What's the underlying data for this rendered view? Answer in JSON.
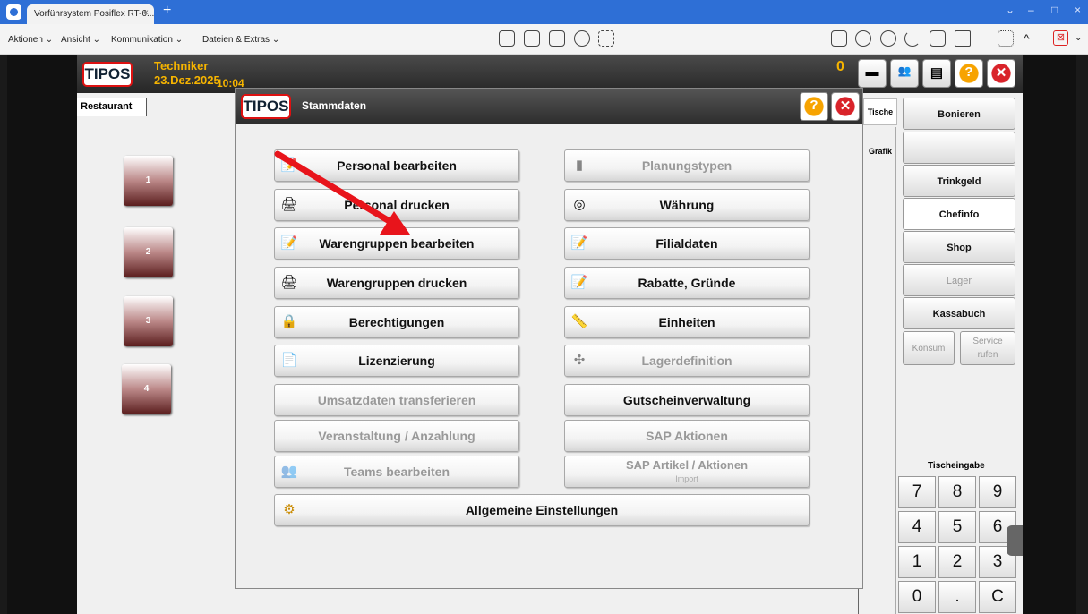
{
  "client": {
    "tab_title": "Vorführsystem Posiflex RT-6...",
    "tab_close": "×",
    "new_tab": "+",
    "window_controls": [
      "⌄",
      "–",
      "□",
      "×"
    ],
    "menus": [
      "Aktionen ⌄",
      "Ansicht ⌄",
      "Kommunikation ⌄",
      "Dateien & Extras ⌄"
    ],
    "toolbar_icons": [
      "monitor-icon",
      "keyboard-icon",
      "file-transfer-icon",
      "camera-icon",
      "grid-icon",
      "clipboard-icon",
      "chat-icon",
      "webcam-icon",
      "call-icon",
      "whiteboard-icon",
      "screenshot-icon",
      "fullscreen-icon",
      "collapse-icon",
      "disconnect-icon"
    ],
    "collapse": "^",
    "disconnect": "⊠",
    "more": "⌄"
  },
  "pos": {
    "logo": "TIPOS",
    "user": "Techniker",
    "date": "23.Dez.2025",
    "time": "10:04",
    "count": "0",
    "header_buttons": {
      "table": "▬",
      "users": "👥",
      "list": "▤",
      "help": "?",
      "close": "✕"
    }
  },
  "restaurant": {
    "tab": "Restaurant",
    "tables": [
      "1",
      "2",
      "3",
      "4"
    ]
  },
  "side_tabs": {
    "tische": "Tische",
    "grafik": "Grafik"
  },
  "right_buttons": [
    {
      "label": "Bonieren",
      "state": "enabled"
    },
    {
      "label": "",
      "state": "enabled"
    },
    {
      "label": "Trinkgeld",
      "state": "enabled"
    },
    {
      "label": "Chefinfo",
      "state": "selected"
    },
    {
      "label": "Shop",
      "state": "enabled"
    },
    {
      "label": "Lager",
      "state": "disabled"
    },
    {
      "label": "Kassabuch",
      "state": "enabled"
    }
  ],
  "small_buttons": {
    "konsum": "Konsum",
    "service_1": "Service",
    "service_2": "rufen"
  },
  "numpad": {
    "label": "Tischeingabe",
    "keys": [
      "7",
      "8",
      "9",
      "4",
      "5",
      "6",
      "1",
      "2",
      "3",
      "0",
      ".",
      "C"
    ]
  },
  "dialog": {
    "logo": "TIPOS",
    "title": "Stammdaten",
    "help": "?",
    "close": "✕",
    "left_buttons": [
      {
        "label": "Personal bearbeiten",
        "icon": "edit-person-icon",
        "glyph": "📝",
        "state": "enabled"
      },
      {
        "label": "Personal drucken",
        "icon": "printer-icon",
        "glyph": "🖨",
        "state": "enabled"
      },
      {
        "label": "Warengruppen bearbeiten",
        "icon": "edit-notepad-icon",
        "glyph": "📝",
        "state": "enabled"
      },
      {
        "label": "Warengruppen drucken",
        "icon": "printer-icon",
        "glyph": "🖨",
        "state": "enabled"
      },
      {
        "label": "Berechtigungen",
        "icon": "lock-user-icon",
        "glyph": "🔒",
        "state": "enabled"
      },
      {
        "label": "Lizenzierung",
        "icon": "license-certificate-icon",
        "glyph": "📄",
        "state": "enabled"
      },
      {
        "label": "Umsatzdaten transferieren",
        "icon": "",
        "glyph": "",
        "state": "disabled"
      },
      {
        "label": "Veranstaltung / Anzahlung",
        "icon": "",
        "glyph": "",
        "state": "disabled"
      },
      {
        "label": "Teams bearbeiten",
        "icon": "team-icon",
        "glyph": "👥",
        "state": "disabled"
      }
    ],
    "right_buttons": [
      {
        "label": "Planungstypen",
        "icon": "bar-chart-icon",
        "glyph": "▮",
        "state": "disabled",
        "sub": ""
      },
      {
        "label": "Währung",
        "icon": "coins-icon",
        "glyph": "◎",
        "state": "enabled",
        "sub": ""
      },
      {
        "label": "Filialdaten",
        "icon": "edit-notepad-icon",
        "glyph": "📝",
        "state": "enabled",
        "sub": ""
      },
      {
        "label": "Rabatte, Gründe",
        "icon": "edit-notepad-icon",
        "glyph": "📝",
        "state": "enabled",
        "sub": ""
      },
      {
        "label": "Einheiten",
        "icon": "measure-ruler-icon",
        "glyph": "📏",
        "state": "enabled",
        "sub": ""
      },
      {
        "label": "Lagerdefinition",
        "icon": "warehouse-network-icon",
        "glyph": "✣",
        "state": "disabled",
        "sub": ""
      },
      {
        "label": "Gutscheinverwaltung",
        "icon": "",
        "glyph": "",
        "state": "enabled",
        "sub": ""
      },
      {
        "label": "SAP Aktionen",
        "icon": "",
        "glyph": "",
        "state": "disabled",
        "sub": ""
      },
      {
        "label": "SAP Artikel / Aktionen",
        "icon": "",
        "glyph": "",
        "state": "disabled",
        "sub": "Import"
      }
    ],
    "wide_button": {
      "label": "Allgemeine Einstellungen",
      "icon": "gears-icon",
      "glyph": "⚙"
    }
  },
  "annotation_color": "#e8141b"
}
